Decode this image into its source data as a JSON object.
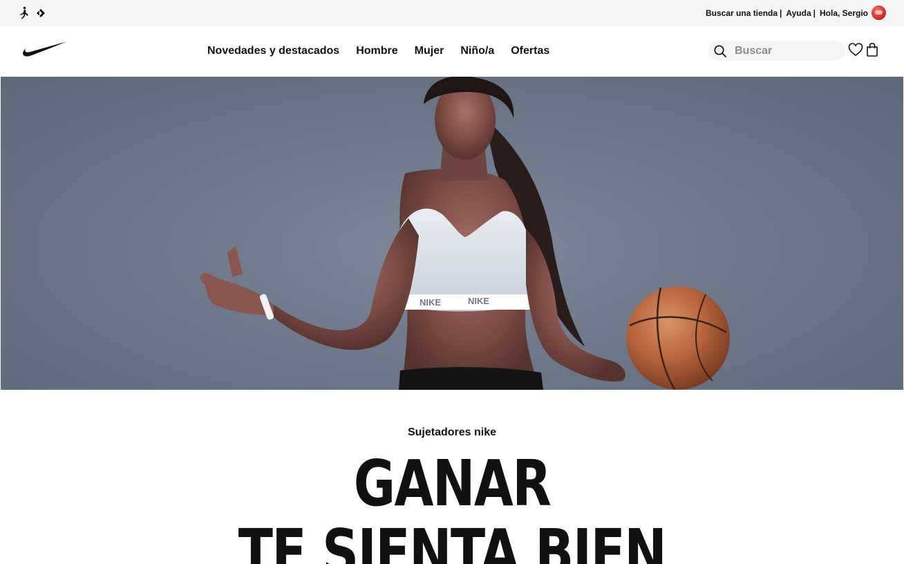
{
  "utility_bar": {
    "brand_icons": [
      "jordan-jumpman-icon",
      "converse-chevron-icon"
    ],
    "links": [
      {
        "label": "Buscar una tienda",
        "separator": "|"
      },
      {
        "label": "Ayuda",
        "separator": "|"
      },
      {
        "label": "Hola, Sergio",
        "separator": ""
      }
    ],
    "avatar_color": "#d8322a"
  },
  "header": {
    "logo": "nike-swoosh-icon",
    "nav": [
      "Novedades y destacados",
      "Hombre",
      "Mujer",
      "Niño/a",
      "Ofertas"
    ],
    "search": {
      "placeholder": "Buscar",
      "value": ""
    },
    "icons": [
      "heart-icon",
      "shopping-bag-icon"
    ]
  },
  "hero": {
    "image": "athlete-with-basketball-photo",
    "background": "#6f788a",
    "top_text": "NIKE"
  },
  "promo": {
    "eyebrow": "Sujetadores nike",
    "headline_line1": "GANAR",
    "headline_line2": "TE SIENTA BIEN"
  }
}
